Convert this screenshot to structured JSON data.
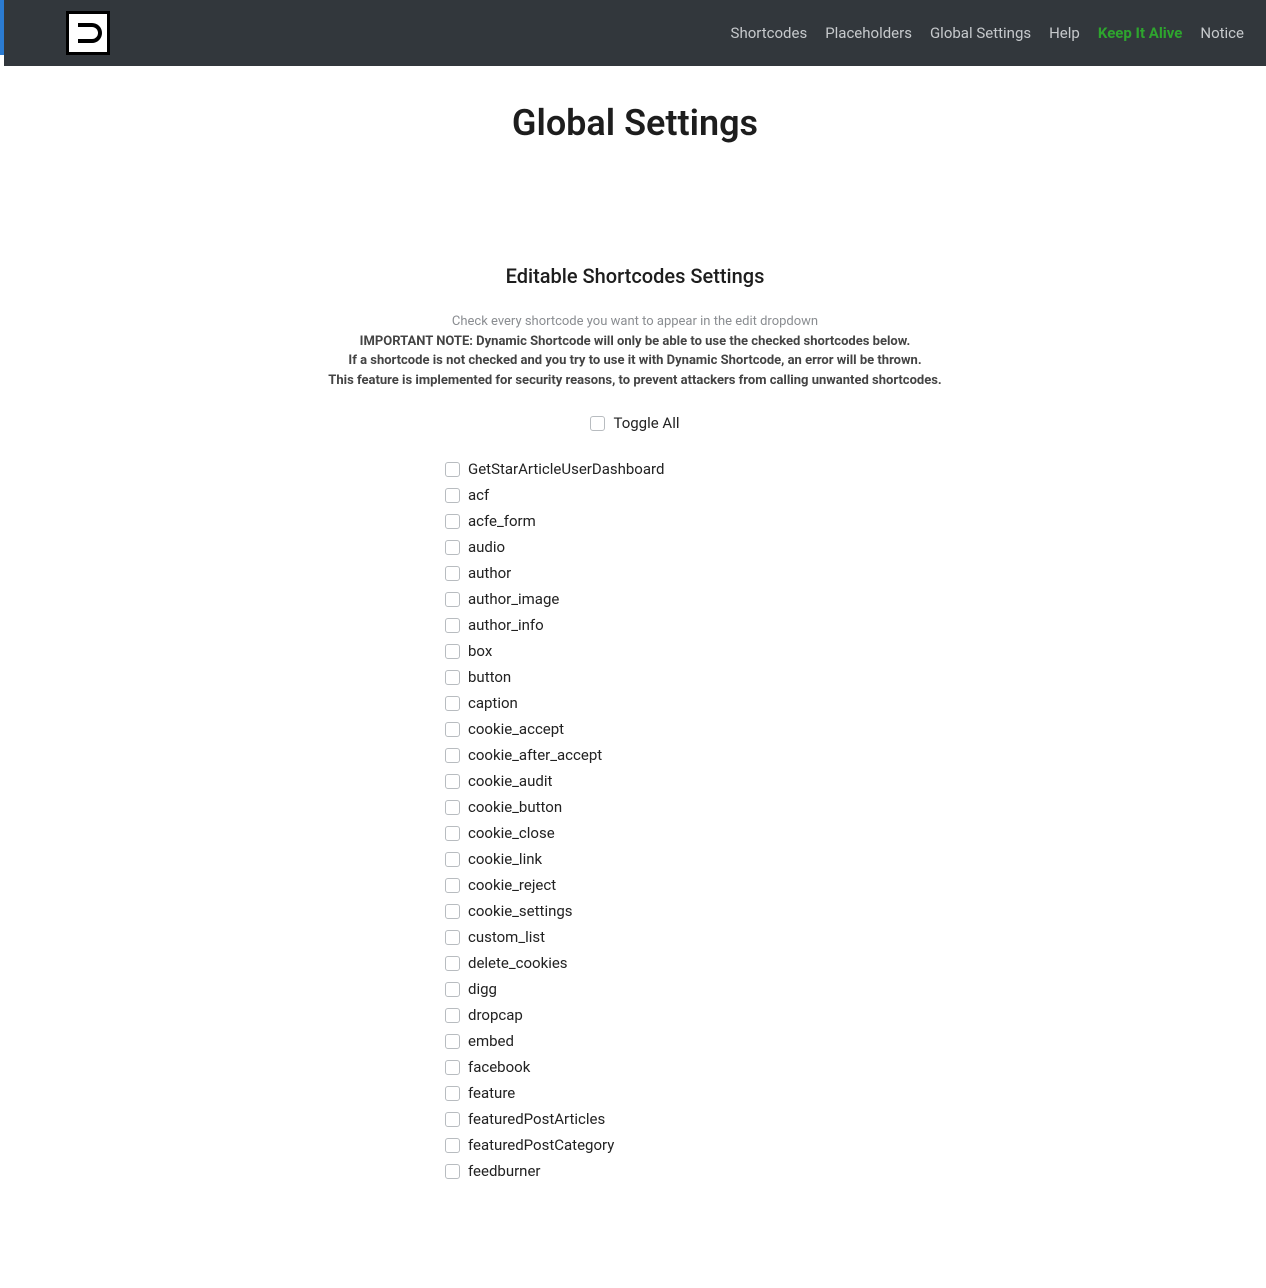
{
  "nav": {
    "items": [
      {
        "label": "Shortcodes"
      },
      {
        "label": "Placeholders"
      },
      {
        "label": "Global Settings"
      },
      {
        "label": "Help"
      },
      {
        "label": "Keep It Alive",
        "class": "keep"
      },
      {
        "label": "Notice"
      }
    ]
  },
  "page": {
    "title": "Global Settings",
    "section_title": "Editable Shortcodes Settings",
    "desc_light": "Check every shortcode you want to appear in the edit dropdown",
    "desc_bold1": "IMPORTANT NOTE: Dynamic Shortcode will only be able to use the checked shortcodes below.",
    "desc_bold2": "If a shortcode is not checked and you try to use it with Dynamic Shortcode, an error will be thrown.",
    "desc_bold3": "This feature is implemented for security reasons, to prevent attackers from calling unwanted shortcodes.",
    "toggle_all": "Toggle All"
  },
  "shortcodes": [
    "GetStarArticleUserDashboard",
    "acf",
    "acfe_form",
    "audio",
    "author",
    "author_image",
    "author_info",
    "box",
    "button",
    "caption",
    "cookie_accept",
    "cookie_after_accept",
    "cookie_audit",
    "cookie_button",
    "cookie_close",
    "cookie_link",
    "cookie_reject",
    "cookie_settings",
    "custom_list",
    "delete_cookies",
    "digg",
    "dropcap",
    "embed",
    "facebook",
    "feature",
    "featuredPostArticles",
    "featuredPostCategory",
    "feedburner"
  ]
}
